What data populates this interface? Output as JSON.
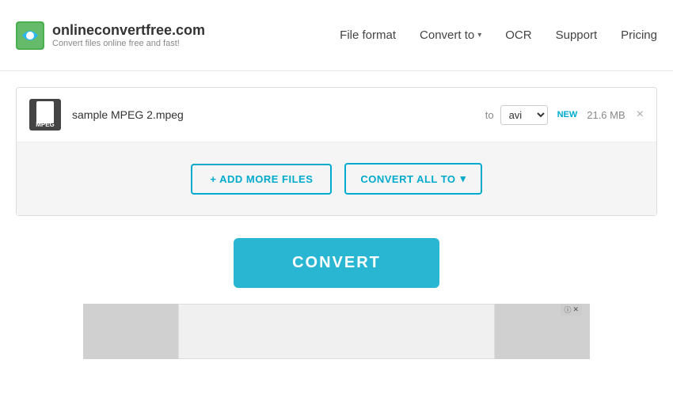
{
  "header": {
    "logo_title": "onlineconvertfree.com",
    "logo_subtitle": "Convert files online free and fast!",
    "nav": {
      "file_format": "File format",
      "convert_to": "Convert to",
      "ocr": "OCR",
      "support": "Support",
      "pricing": "Pricing"
    }
  },
  "file_row": {
    "file_name": "sample MPEG 2.mpeg",
    "file_icon_text": "mpeg",
    "to_label": "to",
    "format_value": "avi",
    "new_badge": "NEW",
    "file_size": "21.6 MB",
    "close_symbol": "×"
  },
  "actions": {
    "add_files_label": "+ ADD MORE FILES",
    "convert_all_label": "CONVERT ALL TO",
    "chevron": "▾"
  },
  "convert_button": {
    "label": "CONVERT"
  },
  "ad": {
    "info_symbol": "ⓘ",
    "close_symbol": "✕"
  }
}
